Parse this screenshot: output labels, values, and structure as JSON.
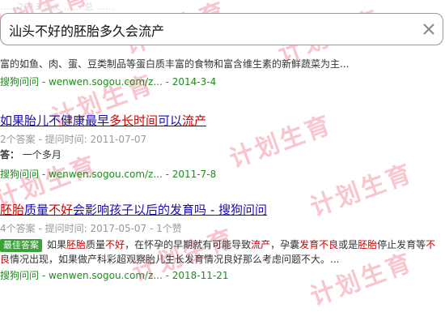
{
  "top_faded_text": "……2013 全义 …… 总 ……",
  "search": {
    "value": "汕头不好的胚胎多久会流产",
    "placeholder": ""
  },
  "results": [
    {
      "snippet": "富的如鱼、肉、蛋、豆类制品等蛋白质丰富的食物和富含维生素的新鲜蔬菜为主...",
      "source": "搜狗问问",
      "url": "wenwen.sogou.com/z...",
      "date": "2014-3-4"
    },
    {
      "title_pre": "如果胎儿不健康最早",
      "title_hl1": "多长时间",
      "title_mid": "可以",
      "title_hl2": "流产",
      "meta": "2个答案 - 提问时间: 2011-07-07",
      "answer_label": "答：",
      "answer_text": "一个多月",
      "source": "搜狗问问",
      "url": "wenwen.sogou.com/z...",
      "date": "2011-7-8"
    },
    {
      "title_hl1": "胚胎",
      "title_mid": "质量",
      "title_hl2": "不好",
      "title_post": "会影响孩子以后的发育吗 - 搜狗问问",
      "meta": "4个答案 - 提问时间: 2017-05-07 - 1个赞",
      "badge": "最佳答案",
      "snippet_parts": [
        "如果",
        "胚胎",
        "质量",
        "不好",
        "，在怀孕的早期就有可能导致",
        "流产",
        "，孕囊",
        "发育不良",
        "或是",
        "胚胎",
        "停止发育等",
        "不良",
        "情况出现，如果做产科彩超观察胎儿生长发育情况良好那么考虑问题不大。..."
      ],
      "source": "搜狗问问",
      "url": "wenwen.sogou.com/z...",
      "date": "2018-11-21"
    }
  ],
  "watermark_text": "计划生育",
  "colors": {
    "link": "#1a0dab",
    "highlight": "#cc0000",
    "url": "#1e8c1e",
    "badge": "#38a438",
    "watermark": "#f7c6cf"
  }
}
